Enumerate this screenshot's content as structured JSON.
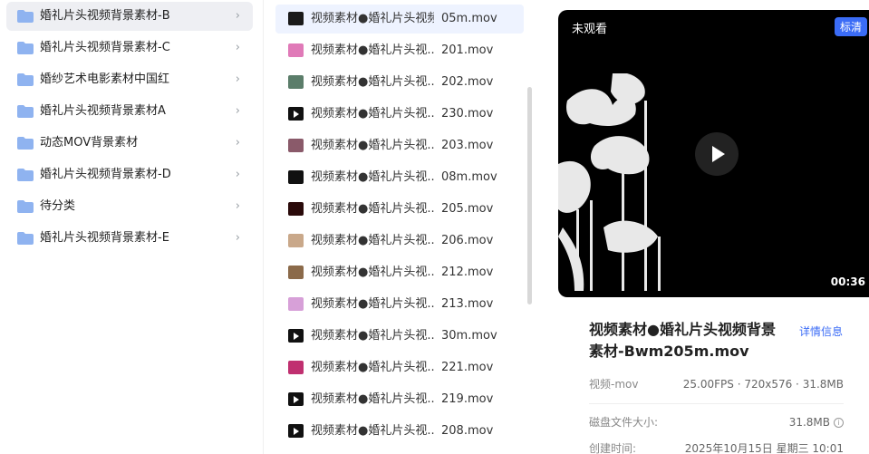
{
  "folders": [
    {
      "label": "婚礼片头视频背景素材-B",
      "selected": true
    },
    {
      "label": "婚礼片头视频背景素材-C"
    },
    {
      "label": "婚纱艺术电影素材中国红"
    },
    {
      "label": "婚礼片头视频背景素材A"
    },
    {
      "label": "动态MOV背景素材"
    },
    {
      "label": "婚礼片头视频背景素材-D"
    },
    {
      "label": "待分类"
    },
    {
      "label": "婚礼片头视频背景素材-E"
    }
  ],
  "folder_chevron": "›",
  "files": [
    {
      "name": "视频素材●婚礼片头视频",
      "end": "05m.mov",
      "thumb": "#1a1a1a",
      "selected": true
    },
    {
      "name": "视频素材●婚礼片头视...",
      "end": "201.mov",
      "thumb": "#e07ab8"
    },
    {
      "name": "视频素材●婚礼片头视...",
      "end": "202.mov",
      "thumb": "#5b7d6a"
    },
    {
      "name": "视频素材●婚礼片头视...",
      "end": "230.mov",
      "thumb": "play"
    },
    {
      "name": "视频素材●婚礼片头视...",
      "end": "203.mov",
      "thumb": "#8a5a6a"
    },
    {
      "name": "视频素材●婚礼片头视...",
      "end": "08m.mov",
      "thumb": "#111111"
    },
    {
      "name": "视频素材●婚礼片头视...",
      "end": "205.mov",
      "thumb": "#2a0a0a"
    },
    {
      "name": "视频素材●婚礼片头视...",
      "end": "206.mov",
      "thumb": "#c9a88a"
    },
    {
      "name": "视频素材●婚礼片头视...",
      "end": "212.mov",
      "thumb": "#8b6a4a"
    },
    {
      "name": "视频素材●婚礼片头视...",
      "end": "213.mov",
      "thumb": "#d7a0d8"
    },
    {
      "name": "视频素材●婚礼片头视...",
      "end": "30m.mov",
      "thumb": "play"
    },
    {
      "name": "视频素材●婚礼片头视...",
      "end": "221.mov",
      "thumb": "#c03070"
    },
    {
      "name": "视频素材●婚礼片头视...",
      "end": "219.mov",
      "thumb": "play"
    },
    {
      "name": "视频素材●婚礼片头视...",
      "end": "208.mov",
      "thumb": "play"
    }
  ],
  "preview": {
    "unwatched": "未观看",
    "quality": "标清",
    "duration": "00:36",
    "title": "视频素材●婚礼片头视频背景素材-Bwm205m.mov",
    "detail_link": "详情信息"
  },
  "meta": {
    "type_key": "视频-mov",
    "type_value": "25.00FPS · 720x576 · 31.8MB",
    "disk_key": "磁盘文件大小:",
    "disk_value": "31.8MB",
    "created_key": "创建时间:",
    "created_value": "2025年10月15日 星期三 10:01"
  },
  "colors": {
    "accent": "#3b6cf6",
    "folder": "#8fb3f0",
    "selected_folder_bg": "#eeeff3",
    "selected_file_bg": "#eef3ff"
  }
}
